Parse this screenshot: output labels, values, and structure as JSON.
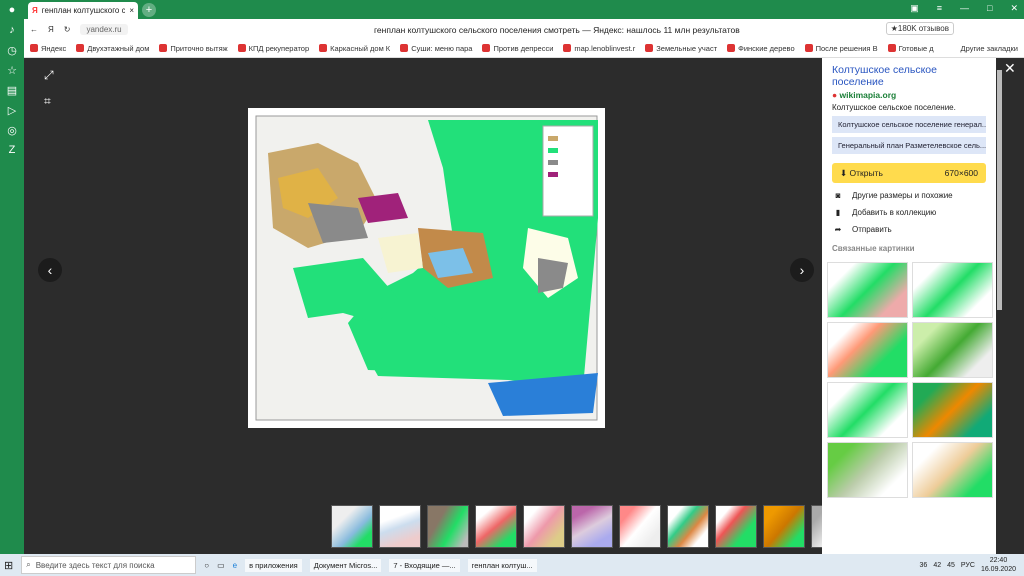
{
  "tab": {
    "title": "генплан колтушского с"
  },
  "address": {
    "url": "yandex.ru",
    "page_title": "генплан колтушского сельского поселения смотреть — Яндекс: нашлось 11 млн результатов",
    "reviews": "★180K отзывов"
  },
  "bookmarks": [
    "Яндекс",
    "Двухэтажный дом",
    "Приточно вытяж",
    "КПД рекуператор",
    "Каркасный дом К",
    "Суши: меню пара",
    "Против депресси",
    "map.lenoblinvest.r",
    "Земельные участ",
    "Финские дерево",
    "После решения В",
    "Готовые д"
  ],
  "bookmarks_more": "Другие закладки",
  "panel": {
    "title": "Колтушское сельское поселение",
    "site": "wikimapia.org",
    "subtitle": "Колтушское сельское поселение.",
    "links": [
      "Колтушское сельское поселение генерал...",
      "Генеральный план Разметелевское сель..."
    ],
    "open_label": "Открыть",
    "size": "670×600",
    "actions": [
      "Другие размеры и похожие",
      "Добавить в коллекцию",
      "Отправить"
    ],
    "related": "Связанные картинки"
  },
  "taskbar": {
    "search_placeholder": "Введите здесь текст для поиска",
    "items": [
      "в приложения",
      "Документ Micros...",
      "7 - Входящие —...",
      "генплан колтуш..."
    ],
    "lang": "РУС",
    "time": "22:40",
    "date": "16.09.2020",
    "n1": "36",
    "n2": "42",
    "n3": "45"
  }
}
